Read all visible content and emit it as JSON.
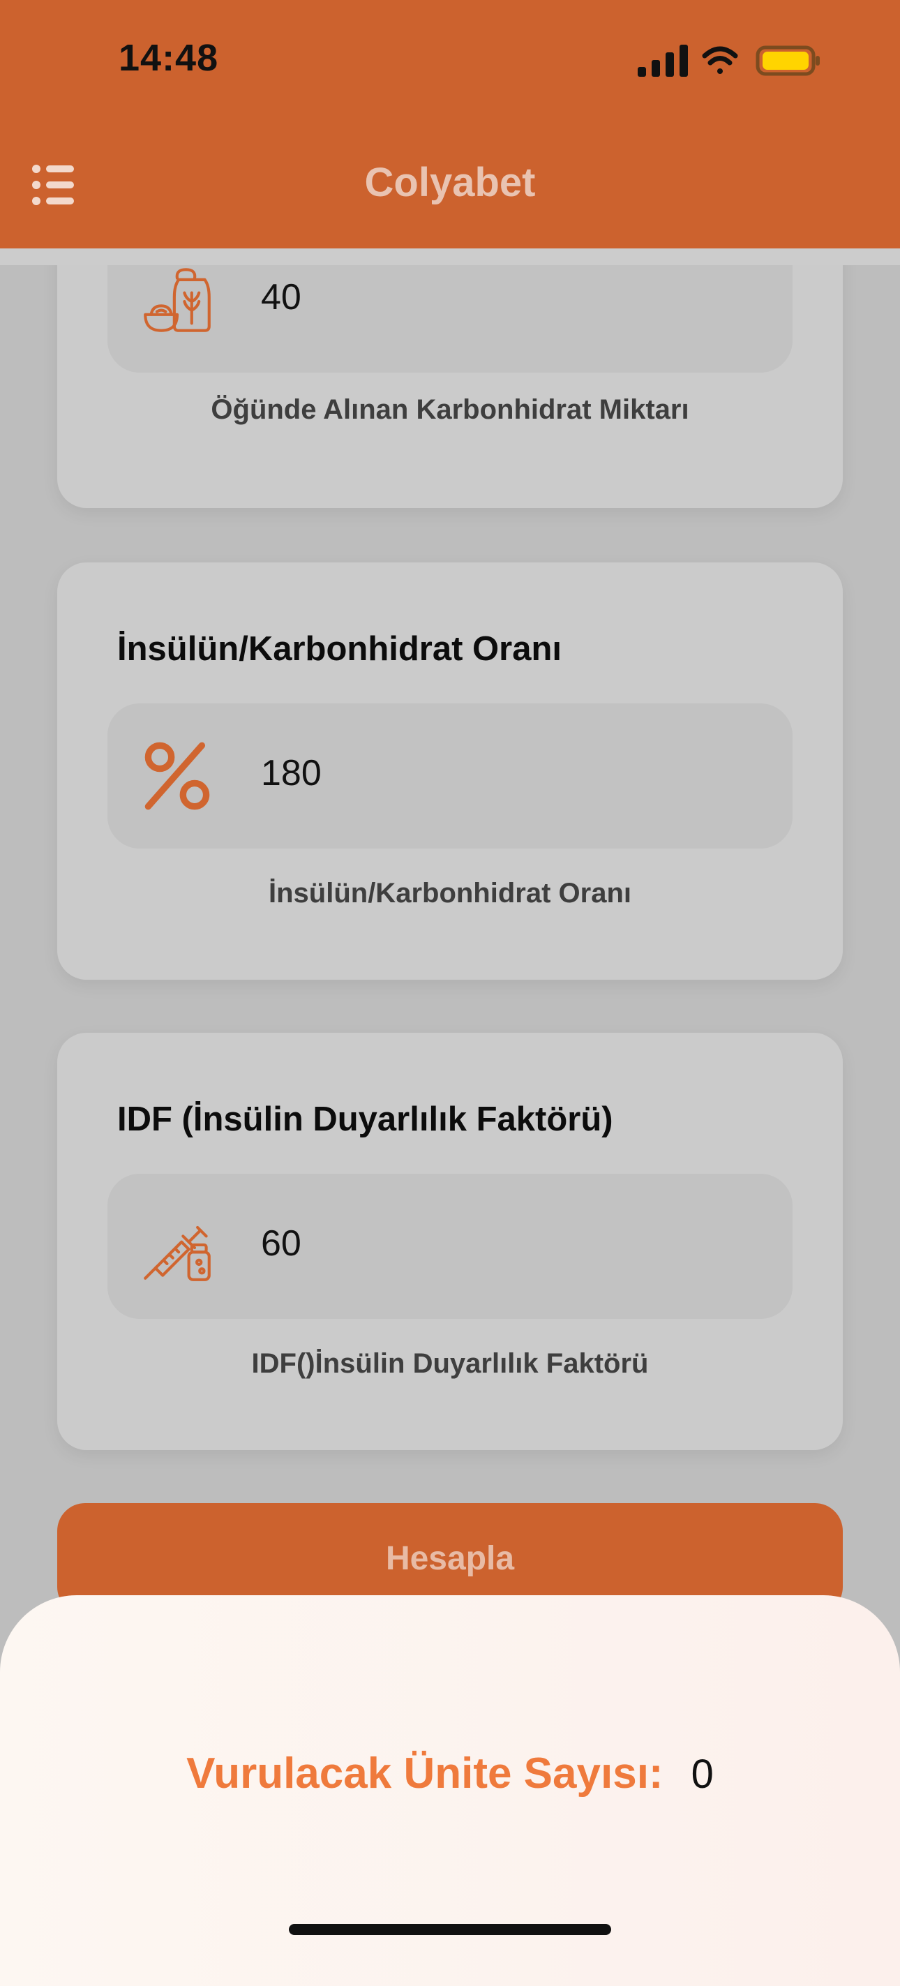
{
  "status_bar": {
    "time": "14:48",
    "battery_color": "#ffd400"
  },
  "header": {
    "title": "Colyabet",
    "menu_icon": "list-icon",
    "background_color": "#cc622e"
  },
  "cards": [
    {
      "title": "",
      "icon": "grain-food-icon",
      "value": "40",
      "helper": "Öğünde Alınan Karbonhidrat Miktarı"
    },
    {
      "title": "İnsülün/Karbonhidrat Oranı",
      "icon": "percent-icon",
      "value": "180",
      "helper": "İnsülün/Karbonhidrat Oranı"
    },
    {
      "title": "IDF (İnsülin Duyarlılık Faktörü)",
      "icon": "syringe-icon",
      "value": "60",
      "helper": "IDF()İnsülin Duyarlılık Faktörü"
    }
  ],
  "calculate_button": {
    "label": "Hesapla"
  },
  "result": {
    "label": "Vurulacak Ünite Sayısı:",
    "value": "0",
    "label_color": "#ef7a3c"
  },
  "accent_color": "#d0652f"
}
